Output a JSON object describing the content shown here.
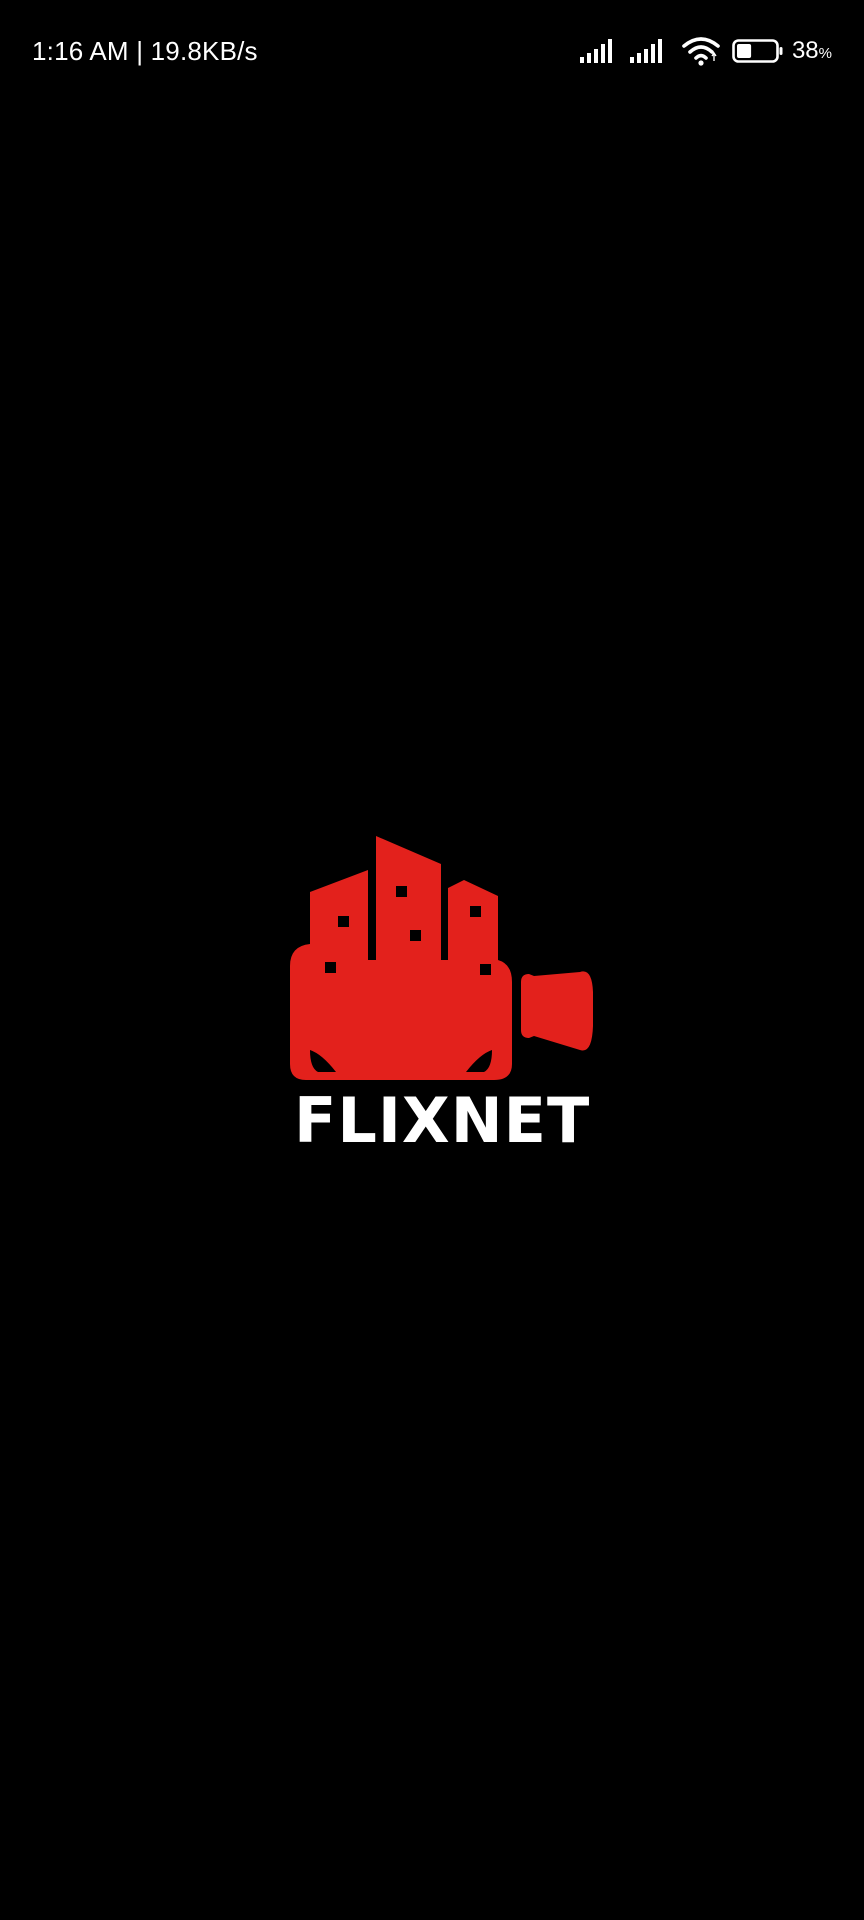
{
  "status_bar": {
    "time": "1:16 AM",
    "separator": "|",
    "network_speed": "19.8KB/s",
    "battery_value": "38",
    "battery_unit": "%",
    "battery_level": 0.38,
    "icons": [
      "signal-strength-icon",
      "signal-strength-icon",
      "wifi-icon",
      "battery-icon"
    ]
  },
  "splash": {
    "brand_name": "FLIXNET",
    "logo_icon": "city-video-camera-logo",
    "colors": {
      "background": "#000000",
      "logo_red": "#e3211c",
      "text": "#ffffff"
    }
  }
}
